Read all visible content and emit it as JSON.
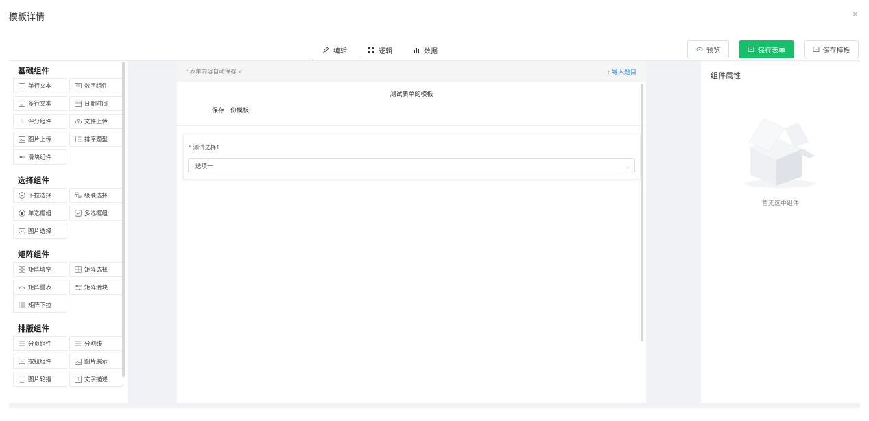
{
  "modal": {
    "title": "模板详情",
    "close": "×"
  },
  "tabs": [
    {
      "label": "编辑",
      "icon": "edit-icon"
    },
    {
      "label": "逻辑",
      "icon": "grid-icon"
    },
    {
      "label": "数据",
      "icon": "bar-chart-icon"
    }
  ],
  "actions": {
    "preview": "预览",
    "save_form": "保存表单",
    "save_template": "保存模板"
  },
  "palette": {
    "basic": {
      "title": "基础组件",
      "items": [
        "单行文本",
        "数字组件",
        "多行文本",
        "日期时间",
        "评分组件",
        "文件上传",
        "图片上传",
        "排序题型",
        "滑块组件"
      ]
    },
    "choice": {
      "title": "选择组件",
      "items": [
        "下拉选择",
        "级联选择",
        "单选框组",
        "多选框组",
        "图片选择"
      ]
    },
    "matrix": {
      "title": "矩阵组件",
      "items": [
        "矩阵填空",
        "矩阵选择",
        "矩阵量表",
        "矩阵滑块",
        "矩阵下拉"
      ]
    },
    "layout": {
      "title": "排版组件",
      "items": [
        "分页组件",
        "分割线",
        "按钮组件",
        "图片展示",
        "图片轮播",
        "文字描述"
      ]
    }
  },
  "canvas": {
    "autosave": "* 表单内容自动保存 ✓",
    "import": "↑  导入题目",
    "form_title": "测试表单的模板",
    "form_desc": "保存一份模板",
    "field": {
      "label": "测试选择1",
      "required_mark": "*",
      "value": "选项一",
      "caret": "⌵"
    }
  },
  "props": {
    "title": "组件属性",
    "empty": "暂无选中组件"
  },
  "colors": {
    "primary": "#2d8cf0",
    "success": "#19be6b",
    "required": "#ed4014"
  }
}
